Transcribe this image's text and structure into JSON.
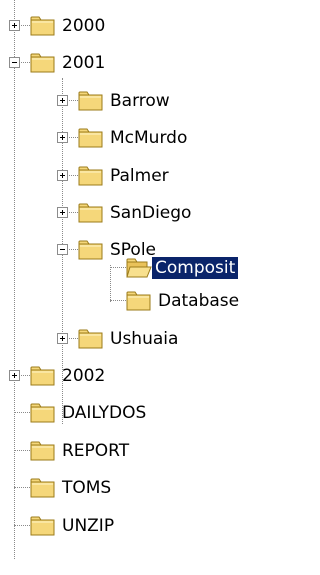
{
  "tree": {
    "colors": {
      "selection_background": "#0a246a",
      "selection_text": "#ffffff",
      "folder_fill": "#f5d77a",
      "folder_stroke": "#9b7b1a"
    },
    "items": [
      {
        "label": "2000",
        "state": "collapsed",
        "icon": "folder-closed-icon"
      },
      {
        "label": "2001",
        "state": "expanded",
        "icon": "folder-closed-icon"
      },
      {
        "label": "Barrow",
        "state": "collapsed",
        "icon": "folder-closed-icon"
      },
      {
        "label": "McMurdo",
        "state": "collapsed",
        "icon": "folder-closed-icon"
      },
      {
        "label": "Palmer",
        "state": "collapsed",
        "icon": "folder-closed-icon"
      },
      {
        "label": "SanDiego",
        "state": "collapsed",
        "icon": "folder-closed-icon"
      },
      {
        "label": "SPole",
        "state": "expanded",
        "icon": "folder-closed-icon"
      },
      {
        "label": "Composit",
        "state": "leaf",
        "selected": true,
        "icon": "folder-open-icon"
      },
      {
        "label": "Database",
        "state": "leaf",
        "icon": "folder-closed-icon"
      },
      {
        "label": "Ushuaia",
        "state": "collapsed",
        "icon": "folder-closed-icon"
      },
      {
        "label": "2002",
        "state": "collapsed",
        "icon": "folder-closed-icon"
      },
      {
        "label": "DAILYDOS",
        "state": "leaf",
        "icon": "folder-closed-icon"
      },
      {
        "label": "REPORT",
        "state": "leaf",
        "icon": "folder-closed-icon"
      },
      {
        "label": "TOMS",
        "state": "leaf",
        "icon": "folder-closed-icon"
      },
      {
        "label": "UNZIP",
        "state": "leaf",
        "icon": "folder-closed-icon"
      }
    ]
  }
}
